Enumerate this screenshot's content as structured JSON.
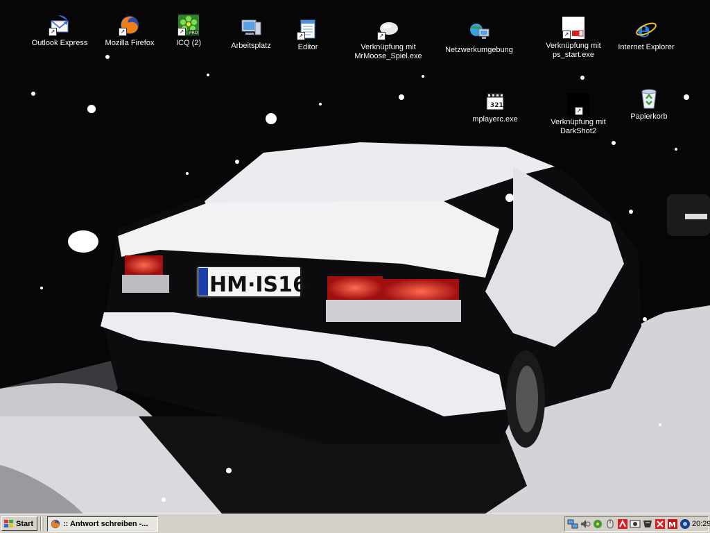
{
  "desktop": {
    "icons": [
      {
        "label": "Outlook Express",
        "icon": "outlook-express-icon"
      },
      {
        "label": "Mozilla Firefox",
        "icon": "firefox-icon"
      },
      {
        "label": "ICQ (2)",
        "icon": "icq-icon"
      },
      {
        "label": "Arbeitsplatz",
        "icon": "my-computer-icon"
      },
      {
        "label": "Editor",
        "icon": "notepad-icon"
      },
      {
        "label": "Verknüpfung mit\nMrMoose_Spiel.exe",
        "icon": "moose-game-icon"
      },
      {
        "label": "Netzwerkumgebung",
        "icon": "network-places-icon"
      },
      {
        "label": "Verknüpfung mit\nps_start.exe",
        "icon": "ps-start-icon"
      },
      {
        "label": "Internet Explorer",
        "icon": "internet-explorer-icon"
      },
      {
        "label": "mplayerc.exe",
        "icon": "media-player-classic-icon"
      },
      {
        "label": "Verknüpfung mit\nDarkShot2",
        "icon": "darkshot-icon"
      },
      {
        "label": "Papierkorb",
        "icon": "recycle-bin-icon"
      }
    ],
    "wallpaper": {
      "plate_text": "HM·IS16"
    }
  },
  "taskbar": {
    "start_label": "Start",
    "task_label": ":: Antwort schreiben -...",
    "clock": "20:29",
    "tray_icons": [
      "network-icon",
      "speaker-icon",
      "icq-tray-icon",
      "mouse-icon",
      "app-red-icon",
      "cdburn-icon",
      "antivirus-icon",
      "tool-icon",
      "msn-icon",
      "monitor-icon"
    ]
  },
  "colors": {
    "taskbar_bg": "#d4d0c8",
    "desktop_bg": "#060606",
    "snow": "#f2f2f4",
    "taillight": "#d81f1f"
  }
}
